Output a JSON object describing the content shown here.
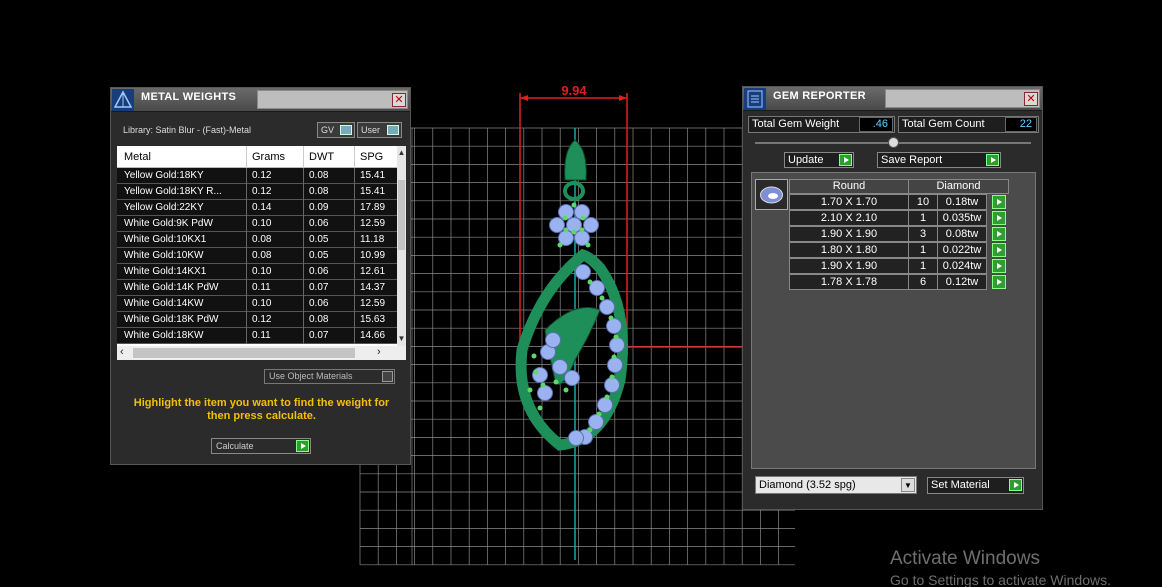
{
  "viewport": {
    "dimension_label": "9.94"
  },
  "metal_weights": {
    "title": "METAL WEIGHTS",
    "close_glyph": "✕",
    "library": "Library: Satin Blur - (Fast)-Metal",
    "toggle_gv": "GV",
    "toggle_user": "User",
    "columns": [
      "Metal",
      "Grams",
      "DWT",
      "SPG"
    ],
    "rows": [
      [
        "Yellow Gold:18KY",
        "0.12",
        "0.08",
        "15.41"
      ],
      [
        "Yellow Gold:18KY R...",
        "0.12",
        "0.08",
        "15.41"
      ],
      [
        "Yellow Gold:22KY",
        "0.14",
        "0.09",
        "17.89"
      ],
      [
        "White Gold:9K PdW",
        "0.10",
        "0.06",
        "12.59"
      ],
      [
        "White Gold:10KX1",
        "0.08",
        "0.05",
        "11.18"
      ],
      [
        "White Gold:10KW",
        "0.08",
        "0.05",
        "10.99"
      ],
      [
        "White Gold:14KX1",
        "0.10",
        "0.06",
        "12.61"
      ],
      [
        "White Gold:14K PdW",
        "0.11",
        "0.07",
        "14.37"
      ],
      [
        "White Gold:14KW",
        "0.10",
        "0.06",
        "12.59"
      ],
      [
        "White Gold:18K PdW",
        "0.12",
        "0.08",
        "15.63"
      ],
      [
        "White Gold:18KW",
        "0.11",
        "0.07",
        "14.66"
      ]
    ],
    "use_object_materials": "Use Object Materials",
    "hint": "Highlight the item you want to find the weight for then press calculate.",
    "calculate": "Calculate"
  },
  "gem_reporter": {
    "title": "GEM REPORTER",
    "close_glyph": "✕",
    "total_weight_label": "Total Gem Weight",
    "total_weight_value": ".46",
    "total_count_label": "Total Gem Count",
    "total_count_value": "22",
    "update": "Update",
    "save_report": "Save Report",
    "col_round": "Round",
    "col_diamond": "Diamond",
    "rows": [
      {
        "size": "1.70 X 1.70",
        "count": "10",
        "weight": "0.18tw"
      },
      {
        "size": "2.10 X 2.10",
        "count": "1",
        "weight": "0.035tw"
      },
      {
        "size": "1.90 X 1.90",
        "count": "3",
        "weight": "0.08tw"
      },
      {
        "size": "1.80 X 1.80",
        "count": "1",
        "weight": "0.022tw"
      },
      {
        "size": "1.90 X 1.90",
        "count": "1",
        "weight": "0.024tw"
      },
      {
        "size": "1.78 X 1.78",
        "count": "6",
        "weight": "0.12tw"
      }
    ],
    "material_select": "Diamond     (3.52 spg)",
    "set_material": "Set Material"
  },
  "watermark": {
    "title": "Activate Windows",
    "subtitle": "Go to Settings to activate Windows."
  },
  "colors": {
    "metal": "#1f8f5a",
    "gem": "#9ab3f0",
    "dimension": "#e02020",
    "highlight_text": "#f2c200"
  }
}
